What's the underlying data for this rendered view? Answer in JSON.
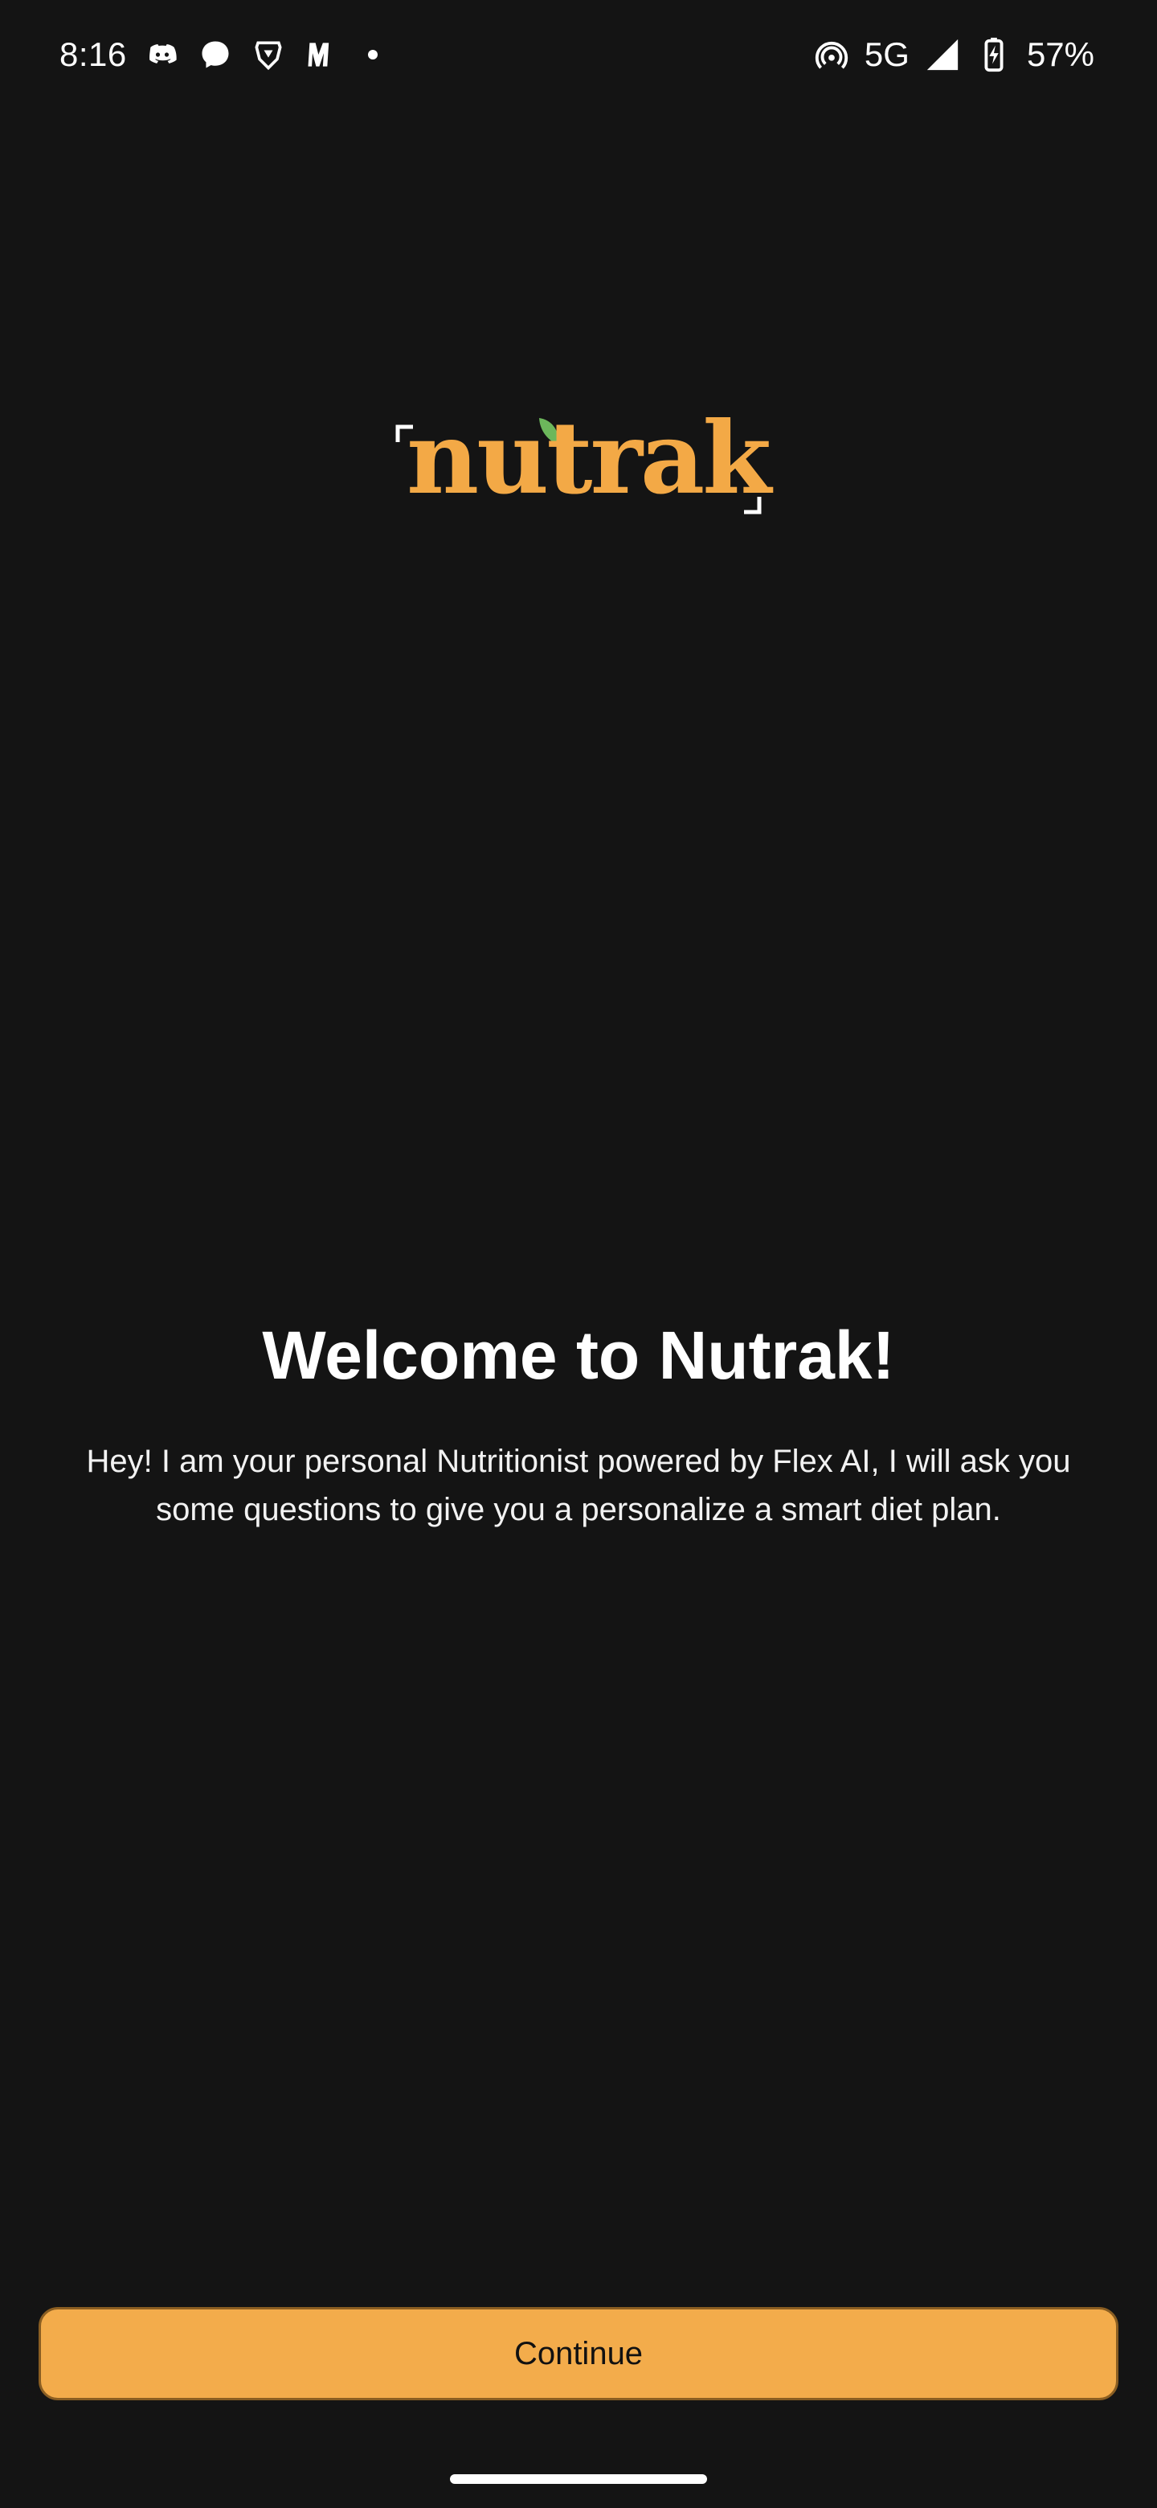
{
  "status_bar": {
    "time": "8:16",
    "network": "5G",
    "battery": "57%",
    "notification_icons": [
      "discord-icon",
      "messenger-icon",
      "brave-icon",
      "myntra-icon"
    ],
    "status_icons": [
      "hotspot-icon",
      "signal-icon",
      "battery-charging-icon"
    ]
  },
  "logo": {
    "text": "nutrak",
    "color": "#f3a946",
    "leaf_color": "#6cb75b"
  },
  "welcome": {
    "title": "Welcome to Nutrak!",
    "body": "Hey! I am your personal Nutritionist powered by Flex AI, I will ask you some questions to give you a personalize a smart diet plan."
  },
  "actions": {
    "continue_label": "Continue"
  },
  "colors": {
    "background": "#141414",
    "accent": "#f3ac4b"
  }
}
